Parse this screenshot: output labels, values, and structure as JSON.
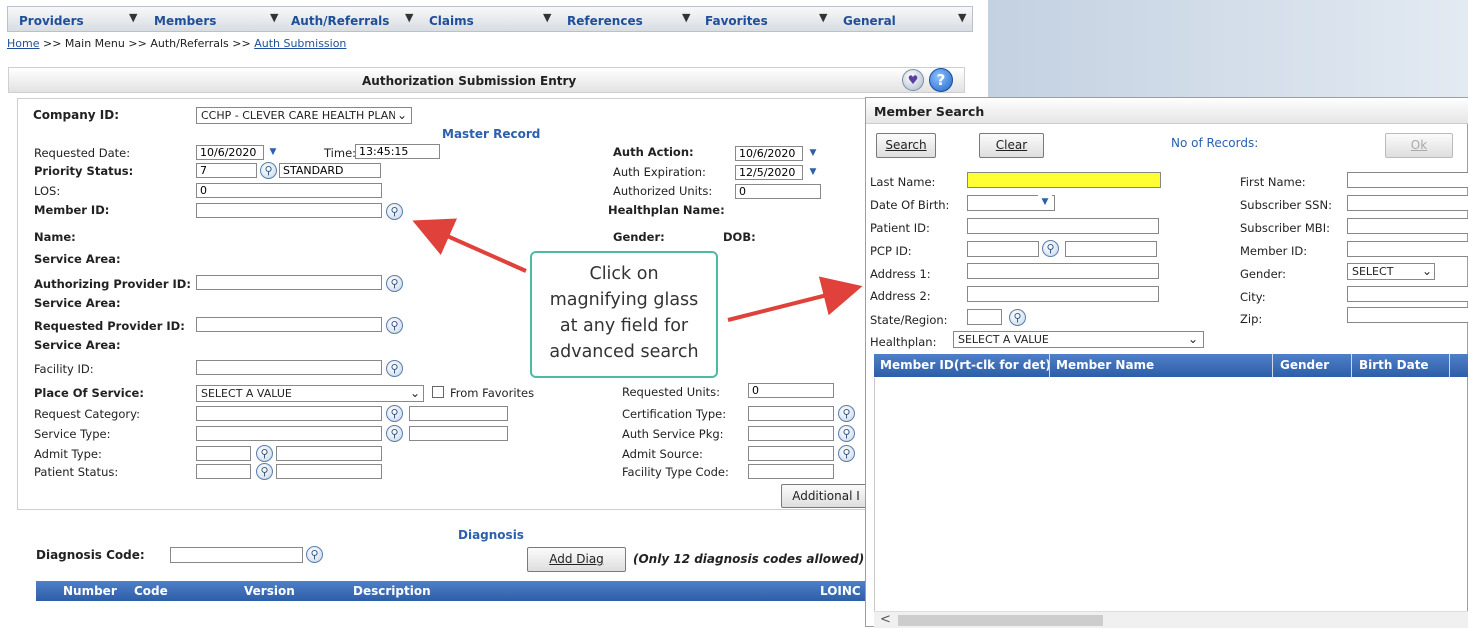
{
  "nav": {
    "items": [
      "Providers",
      "Members",
      "Auth/Referrals",
      "Claims",
      "References",
      "Favorites",
      "General"
    ]
  },
  "breadcrumb": {
    "home": "Home",
    "sep1": ">>",
    "main_menu": "Main Menu",
    "sep2": ">>",
    "auth_referrals": "Auth/Referrals",
    "sep3": ">>",
    "current": "Auth Submission"
  },
  "page": {
    "title": "Authorization Submission Entry"
  },
  "form": {
    "company_id_label": "Company ID:",
    "company_id_value": "CCHP - CLEVER CARE HEALTH PLAN",
    "master_record_heading": "Master Record",
    "requested_date_label": "Requested Date:",
    "requested_date_value": "10/6/2020",
    "time_label": "Time:",
    "time_value": "13:45:15",
    "priority_status_label": "Priority Status:",
    "priority_status_code": "7",
    "priority_status_text": "STANDARD",
    "los_label": "LOS:",
    "los_value": "0",
    "member_id_label": "Member ID:",
    "member_id_value": "",
    "name_label": "Name:",
    "service_area_label": "Service Area:",
    "auth_provider_label": "Authorizing Provider ID:",
    "service_area_label_2": "Service Area:",
    "req_provider_label": "Requested Provider ID:",
    "service_area_label_3": "Service Area:",
    "facility_id_label": "Facility ID:",
    "place_of_service_label": "Place Of Service:",
    "place_of_service_value": "SELECT A VALUE",
    "from_favorites_label": "From Favorites",
    "request_category_label": "Request Category:",
    "service_type_label": "Service Type:",
    "admit_type_label": "Admit Type:",
    "patient_status_label": "Patient Status:",
    "auth_action_label": "Auth Action:",
    "auth_action_value": "10/6/2020",
    "auth_expiration_label": "Auth Expiration:",
    "auth_expiration_value": "12/5/2020",
    "authorized_units_label": "Authorized Units:",
    "authorized_units_value": "0",
    "healthplan_name_label": "Healthplan Name:",
    "gender_label": "Gender:",
    "dob_label": "DOB:",
    "requested_units_label": "Requested Units:",
    "requested_units_value": "0",
    "certification_type_label": "Certification Type:",
    "auth_service_pkg_label": "Auth Service Pkg:",
    "admit_source_label": "Admit Source:",
    "facility_type_code_label": "Facility Type Code:",
    "additional_button": "Additional I"
  },
  "diagnosis": {
    "heading": "Diagnosis",
    "code_label": "Diagnosis Code:",
    "add_button": "Add Diag",
    "note": "(Only 12 diagnosis codes allowed)",
    "columns": [
      "Number",
      "Code",
      "Version",
      "Description",
      "LOINC C"
    ]
  },
  "callout": {
    "lines": [
      "Click on",
      "magnifying glass",
      "at any field for",
      "advanced search"
    ],
    "color": "#4dbba3"
  },
  "member_search": {
    "title": "Member Search",
    "search_button": "Search",
    "clear_button": "Clear",
    "records_label": "No of Records:",
    "ok_button": "Ok",
    "last_name_label": "Last Name:",
    "dob_label": "Date Of Birth:",
    "patient_id_label": "Patient ID:",
    "pcp_id_label": "PCP ID:",
    "address1_label": "Address 1:",
    "address2_label": "Address 2:",
    "state_label": "State/Region:",
    "healthplan_label": "Healthplan:",
    "healthplan_value": "SELECT A VALUE",
    "first_name_label": "First Name:",
    "subscriber_ssn_label": "Subscriber SSN:",
    "subscriber_mbi_label": "Subscriber MBI:",
    "member_id_label": "Member ID:",
    "gender_label": "Gender:",
    "gender_value": "SELECT",
    "city_label": "City:",
    "zip_label": "Zip:",
    "columns": [
      "Member ID(rt-clk for det)",
      "Member Name",
      "Gender",
      "Birth Date"
    ],
    "scroll_left": "<"
  },
  "colors": {
    "nav_text": "#1f4f99",
    "header_blue": "#2d5ea8",
    "highlight_yellow": "#ffff33",
    "arrow_red": "#e0413a",
    "callout_border": "#4dbba3"
  }
}
